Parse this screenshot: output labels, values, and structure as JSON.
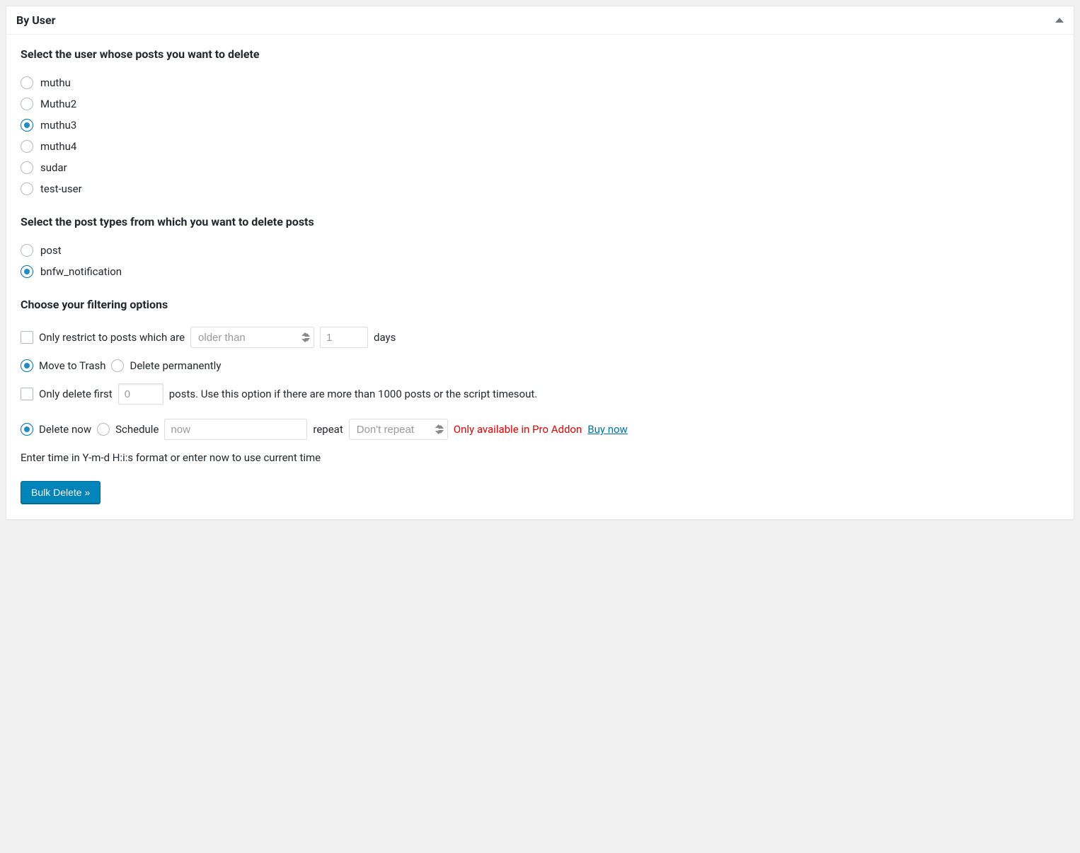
{
  "panel": {
    "title": "By User"
  },
  "sections": {
    "select_user": "Select the user whose posts you want to delete",
    "select_post_types": "Select the post types from which you want to delete posts",
    "filtering": "Choose your filtering options"
  },
  "users": [
    {
      "name": "muthu",
      "selected": false
    },
    {
      "name": "Muthu2",
      "selected": false
    },
    {
      "name": "muthu3",
      "selected": true
    },
    {
      "name": "muthu4",
      "selected": false
    },
    {
      "name": "sudar",
      "selected": false
    },
    {
      "name": "test-user",
      "selected": false
    }
  ],
  "post_types": [
    {
      "name": "post",
      "selected": false
    },
    {
      "name": "bnfw_notification",
      "selected": true
    }
  ],
  "filters": {
    "restrict_label": "Only restrict to posts which are",
    "restrict_select": "older than",
    "restrict_days_value": "1",
    "restrict_days_suffix": "days",
    "move_trash_label": "Move to Trash",
    "delete_permanently_label": "Delete permanently",
    "only_delete_first_label": "Only delete first",
    "only_delete_first_value": "0",
    "only_delete_first_suffix": "posts. Use this option if there are more than 1000 posts or the script timesout.",
    "delete_now_label": "Delete now",
    "schedule_label": "Schedule",
    "schedule_value": "now",
    "repeat_label": "repeat",
    "repeat_select": "Don't repeat",
    "pro_addon_text": "Only available in Pro Addon",
    "buy_now_text": "Buy now",
    "time_hint": "Enter time in Y-m-d H:i:s format or enter now to use current time"
  },
  "button": {
    "bulk_delete": "Bulk Delete »"
  }
}
